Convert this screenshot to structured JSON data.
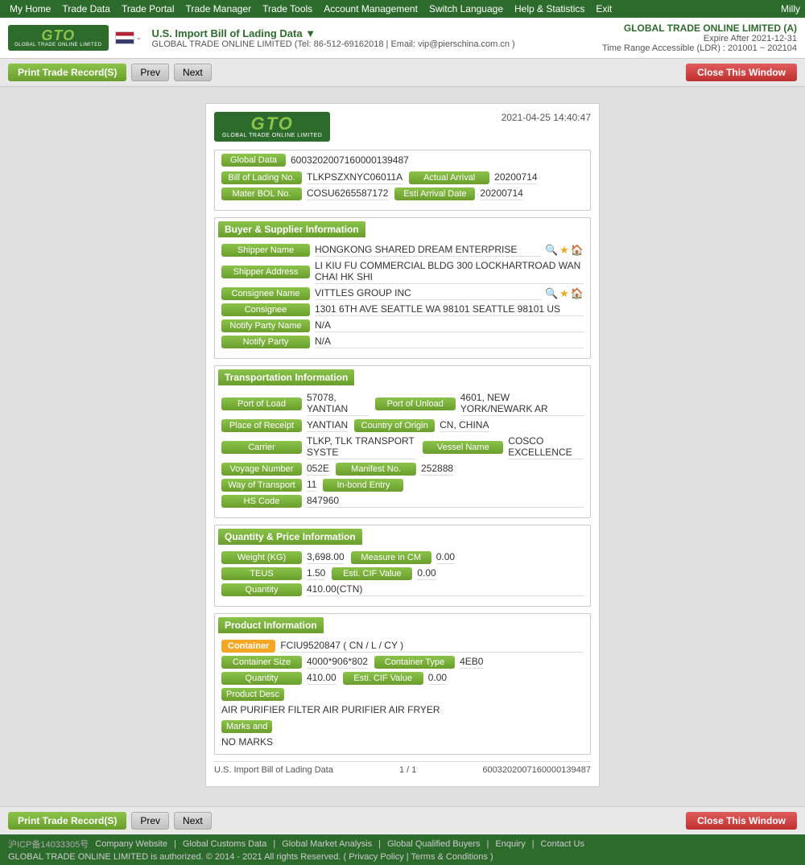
{
  "topNav": {
    "items": [
      {
        "label": "My Home",
        "hasArrow": true
      },
      {
        "label": "Trade Data",
        "hasArrow": true
      },
      {
        "label": "Trade Portal",
        "hasArrow": true
      },
      {
        "label": "Trade Manager",
        "hasArrow": true
      },
      {
        "label": "Trade Tools",
        "hasArrow": true
      },
      {
        "label": "Account Management",
        "hasArrow": true
      },
      {
        "label": "Switch Language",
        "hasArrow": true
      },
      {
        "label": "Help & Statistics",
        "hasArrow": true
      },
      {
        "label": "Exit",
        "hasArrow": false
      }
    ],
    "user": "Milly"
  },
  "header": {
    "logoText": "GTO",
    "logoSub": "GLOBAL TRADE ONLINE LIMITED",
    "titleMain": "U.S. Import Bill of Lading Data ▼",
    "titleSub": "GLOBAL TRADE ONLINE LIMITED (Tel: 86-512-69162018 | Email: vip@pierschina.com.cn )",
    "companyName": "GLOBAL TRADE ONLINE LIMITED (A)",
    "expireAfter": "Expire After 2021-12-31",
    "timeRange": "Time Range Accessible (LDR) : 201001 ~ 202104"
  },
  "toolbar": {
    "printLabel": "Print Trade Record(S)",
    "prevLabel": "Prev",
    "nextLabel": "Next",
    "closeLabel": "Close This Window"
  },
  "document": {
    "timestamp": "2021-04-25 14:40:47",
    "globalData": {
      "label": "Global Data",
      "value": "6003202007160000139487"
    },
    "bolNo": {
      "label": "Bill of Lading No.",
      "value": "TLKPSZXNYC06011A"
    },
    "actualArrival": {
      "label": "Actual Arrival",
      "value": "20200714"
    },
    "masterBolNo": {
      "label": "Mater BOL No.",
      "value": "COSU6265587172"
    },
    "estiArrival": {
      "label": "Esti Arrival Date",
      "value": "20200714"
    },
    "buyerSupplier": {
      "sectionTitle": "Buyer & Supplier Information",
      "shipperName": {
        "label": "Shipper Name",
        "value": "HONGKONG SHARED DREAM ENTERPRISE"
      },
      "shipperAddress": {
        "label": "Shipper Address",
        "value": "LI KIU FU COMMERCIAL BLDG 300 LOCKHARTROAD WAN CHAI HK SHI"
      },
      "consigneeName": {
        "label": "Consignee Name",
        "value": "VITTLES GROUP INC"
      },
      "consignee": {
        "label": "Consignee",
        "value": "1301 6TH AVE SEATTLE WA 98101 SEATTLE 98101 US"
      },
      "notifyPartyName": {
        "label": "Notify Party Name",
        "value": "N/A"
      },
      "notifyParty": {
        "label": "Notify Party",
        "value": "N/A"
      }
    },
    "transportation": {
      "sectionTitle": "Transportation Information",
      "portOfLoad": {
        "label": "Port of Load",
        "value": "57078, YANTIAN"
      },
      "portOfUnload": {
        "label": "Port of Unload",
        "value": "4601, NEW YORK/NEWARK AR"
      },
      "placeOfReceipt": {
        "label": "Place of Receipt",
        "value": "YANTIAN"
      },
      "countryOfOrigin": {
        "label": "Country of Origin",
        "value": "CN, CHINA"
      },
      "carrier": {
        "label": "Carrier",
        "value": "TLKP, TLK TRANSPORT SYSTE"
      },
      "vesselName": {
        "label": "Vessel Name",
        "value": "COSCO EXCELLENCE"
      },
      "voyageNumber": {
        "label": "Voyage Number",
        "value": "052E"
      },
      "manifestNo": {
        "label": "Manifest No.",
        "value": "252888"
      },
      "wayOfTransport": {
        "label": "Way of Transport",
        "value": "11"
      },
      "inBondEntry": {
        "label": "In-bond Entry",
        "value": ""
      },
      "hsCode": {
        "label": "HS Code",
        "value": "847960"
      }
    },
    "quantity": {
      "sectionTitle": "Quantity & Price Information",
      "weight": {
        "label": "Weight (KG)",
        "value": "3,698.00"
      },
      "measureInCM": {
        "label": "Measure in CM",
        "value": "0.00"
      },
      "teus": {
        "label": "TEUS",
        "value": "1.50"
      },
      "estiCIF": {
        "label": "Esti. CIF Value",
        "value": "0.00"
      },
      "quantityLabel": "Quantity",
      "quantityValue": "410.00(CTN)"
    },
    "product": {
      "sectionTitle": "Product Information",
      "containerBadge": "Container",
      "containerValue": "FCIU9520847 ( CN / L / CY )",
      "containerSize": {
        "label": "Container Size",
        "value": "4000*906*802"
      },
      "containerType": {
        "label": "Container Type",
        "value": "4EB0"
      },
      "quantityLabel": "Quantity",
      "quantityValue": "410.00",
      "estiCIF": {
        "label": "Esti. CIF Value",
        "value": "0.00"
      },
      "productDescLabel": "Product Desc",
      "productDescValue": "AIR PURIFIER FILTER AIR PURIFIER AIR FRYER",
      "marksLabel": "Marks and",
      "marksValue": "NO MARKS"
    },
    "footer": {
      "left": "U.S. Import Bill of Lading Data",
      "center": "1 / 1",
      "right": "6003202007160000139487"
    }
  },
  "bottomToolbar": {
    "printLabel": "Print Trade Record(S)",
    "prevLabel": "Prev",
    "nextLabel": "Next",
    "closeLabel": "Close This Window"
  },
  "footer": {
    "icp": "沪ICP备14033305号",
    "links": [
      "Company Website",
      "Global Customs Data",
      "Global Market Analysis",
      "Global Qualified Buyers",
      "Enquiry",
      "Contact Us"
    ],
    "copyright": "GLOBAL TRADE ONLINE LIMITED is authorized. © 2014 - 2021 All rights Reserved.",
    "privacyPolicy": "Privacy Policy",
    "termsConditions": "Terms & Conditions"
  }
}
